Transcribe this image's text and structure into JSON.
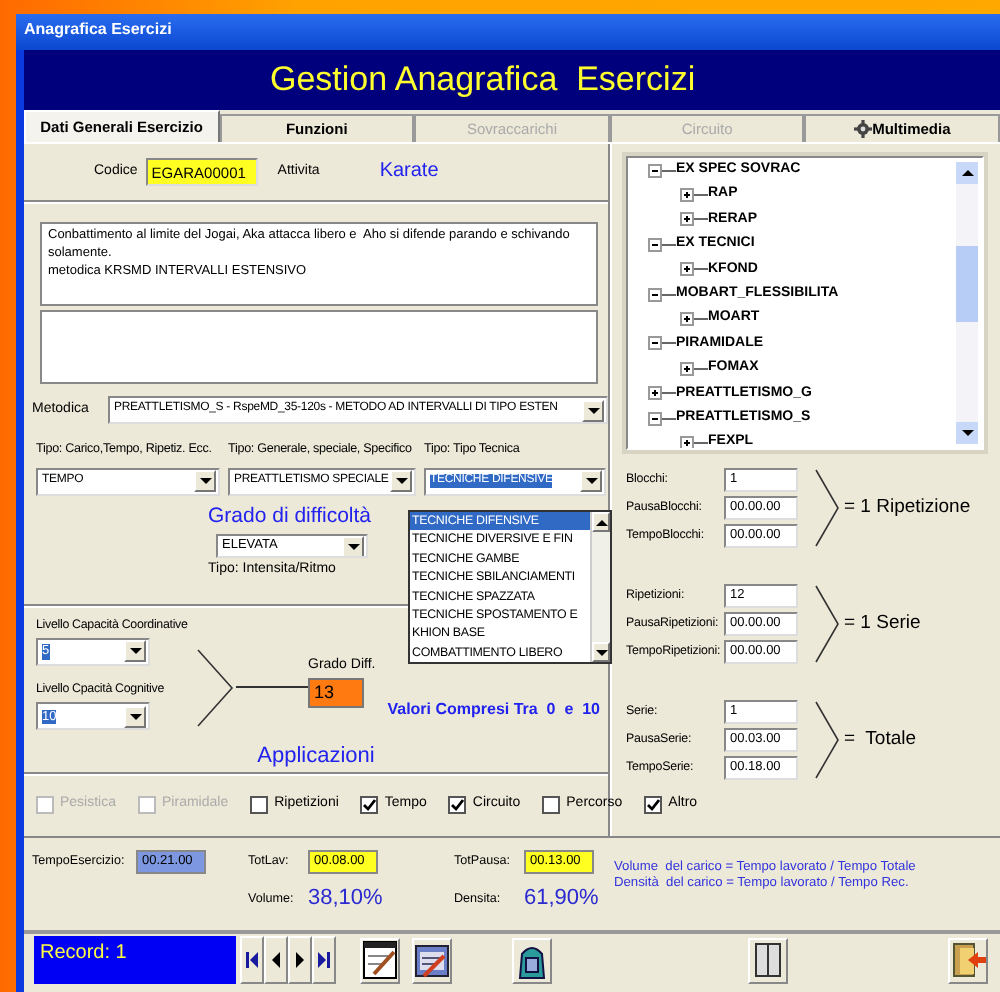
{
  "window": {
    "title": "Anagrafica Esercizi"
  },
  "header": {
    "title": "Gestion Anagrafica  Esercizi"
  },
  "tabs": [
    {
      "label": "Dati Generali Esercizio",
      "selected": true,
      "disabled": false,
      "icon": false
    },
    {
      "label": "Funzioni",
      "selected": false,
      "disabled": false,
      "icon": false
    },
    {
      "label": "Sovraccarichi",
      "selected": false,
      "disabled": true,
      "icon": false
    },
    {
      "label": "Circuito",
      "selected": false,
      "disabled": true,
      "icon": false
    },
    {
      "label": "Multimedia",
      "selected": false,
      "disabled": false,
      "icon": true
    }
  ],
  "codice": {
    "label": "Codice",
    "value": "EGARA00001"
  },
  "attivita": {
    "label": "Attivita",
    "value": "Karate"
  },
  "description": "Conbattimento al limite del Jogai, Aka attacca libero e  Aho si difende parando e schivando solamente.\nmetodica KRSMD INTERVALLI ESTENSIVO",
  "metodica": {
    "label": "Metodica",
    "value": "PREATTLETISMO_S - RspeMD_35-120s - METODO AD INTERVALLI DI TIPO ESTEN"
  },
  "tipi": [
    {
      "label": "Tipo: Carico,Tempo, Ripetiz. Ecc.",
      "value": "TEMPO",
      "focused": false
    },
    {
      "label": "Tipo: Generale, speciale, Specifico",
      "value": "PREATTLETISMO SPECIALE",
      "focused": false
    },
    {
      "label": "Tipo: Tipo Tecnica",
      "value": "TECNICHE DIFENSIVE",
      "focused": true
    }
  ],
  "dropdown": {
    "items": [
      {
        "label": "TECNICHE DIFENSIVE",
        "selected": true
      },
      {
        "label": "TECNICHE DIVERSIVE E FIN",
        "selected": false
      },
      {
        "label": "TECNICHE GAMBE",
        "selected": false
      },
      {
        "label": "TECNICHE SBILANCIAMENTI",
        "selected": false
      },
      {
        "label": "TECNICHE SPAZZATA",
        "selected": false
      },
      {
        "label": "TECNICHE SPOSTAMENTO E",
        "selected": false
      },
      {
        "label": "KHION BASE",
        "selected": false
      },
      {
        "label": "COMBATTIMENTO LIBERO",
        "selected": false
      }
    ]
  },
  "grado_di_difficolta": {
    "title": "Grado di difficoltà",
    "value": "ELEVATA",
    "caption": "Tipo: Intensita/Ritmo"
  },
  "livelli": [
    {
      "label": "Livello Capacità Coordinative",
      "value": "5"
    },
    {
      "label": "Livello Cpacità Cognitive",
      "value": "10"
    }
  ],
  "grado_diff": {
    "label": "Grado Diff.",
    "value": "13"
  },
  "range_note": "Valori Compresi Tra  0  e  10",
  "applicazioni": {
    "title": "Applicazioni",
    "options": [
      {
        "label": "Pesistica",
        "checked": false,
        "disabled": true
      },
      {
        "label": "Piramidale",
        "checked": false,
        "disabled": true
      },
      {
        "label": "Ripetizioni",
        "checked": false,
        "disabled": false
      },
      {
        "label": "Tempo",
        "checked": true,
        "disabled": false
      },
      {
        "label": "Circuito",
        "checked": true,
        "disabled": false
      },
      {
        "label": "Percorso",
        "checked": false,
        "disabled": false
      },
      {
        "label": "Altro",
        "checked": true,
        "disabled": false
      }
    ]
  },
  "tree": [
    {
      "label": "EX SPEC SOVRAC",
      "expanded": true,
      "children": [
        {
          "label": "RAP",
          "expanded": false
        },
        {
          "label": "RERAP",
          "expanded": false
        }
      ]
    },
    {
      "label": "EX TECNICI",
      "expanded": true,
      "children": [
        {
          "label": "KFOND",
          "expanded": false
        }
      ]
    },
    {
      "label": "MOBART_FLESSIBILITA",
      "expanded": true,
      "children": [
        {
          "label": "MOART",
          "expanded": false
        }
      ]
    },
    {
      "label": "PIRAMIDALE",
      "expanded": true,
      "children": [
        {
          "label": "FOMAX",
          "expanded": false
        }
      ]
    },
    {
      "label": "PREATTLETISMO_G",
      "expanded": false
    },
    {
      "label": "PREATTLETISMO_S",
      "expanded": true,
      "children": [
        {
          "label": "FEXPL",
          "expanded": false
        }
      ]
    }
  ],
  "groups": [
    {
      "fields": [
        {
          "label": "Blocchi:",
          "value": "1"
        },
        {
          "label": "PausaBlocchi:",
          "value": "00.00.00"
        },
        {
          "label": "TempoBlocchi:",
          "value": "00.00.00"
        }
      ],
      "result": "= 1 Ripetizione"
    },
    {
      "fields": [
        {
          "label": "Ripetizioni:",
          "value": "12"
        },
        {
          "label": "PausaRipetizioni:",
          "value": "00.00.00"
        },
        {
          "label": "TempoRipetizioni:",
          "value": "00.00.00"
        }
      ],
      "result": "= 1 Serie"
    },
    {
      "fields": [
        {
          "label": "Serie:",
          "value": "1"
        },
        {
          "label": "PausaSerie:",
          "value": "00.03.00"
        },
        {
          "label": "TempoSerie:",
          "value": "00.18.00"
        }
      ],
      "result": "=  Totale"
    }
  ],
  "totals": {
    "tempo_esercizio": {
      "label": "TempoEsercizio:",
      "value": "00.21.00"
    },
    "tot_lav": {
      "label": "TotLav:",
      "value": "00.08.00"
    },
    "tot_pausa": {
      "label": "TotPausa:",
      "value": "00.13.00"
    },
    "volume": {
      "label": "Volume:",
      "value": "38,10%"
    },
    "densita": {
      "label": "Densita:",
      "value": "61,90%"
    }
  },
  "formulas": [
    "Volume  del carico = Tempo lavorato / Tempo Totale",
    "Densità  del carico = Tempo lavorato / Tempo Rec."
  ],
  "record": "Record: 1"
}
